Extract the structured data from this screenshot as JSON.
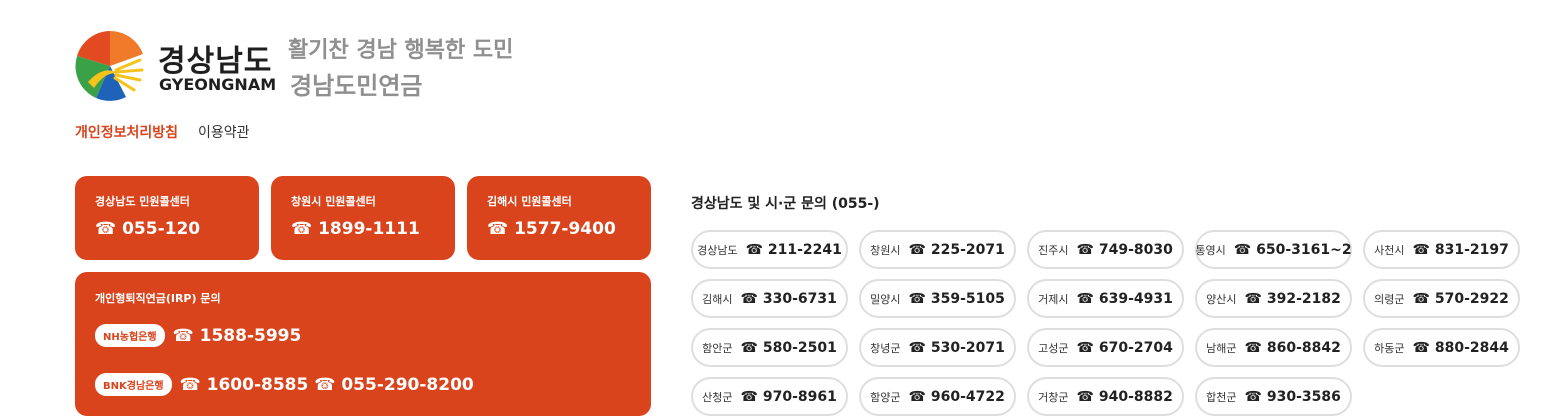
{
  "header": {
    "brand_ko": "경상남도",
    "brand_en": "GYEONGNAM",
    "slogan": "활기찬 경남 행복한 도민",
    "site_title": "경남도민연금"
  },
  "links": [
    {
      "label": "개인정보처리방침"
    },
    {
      "label": "이용약관"
    }
  ],
  "cards": [
    {
      "caption": "경상남도 민원콜센터",
      "phone": "☎ 055-120"
    },
    {
      "caption": "창원시 민원콜센터",
      "phone": "☎ 1899-1111"
    },
    {
      "caption": "김해시 민원콜센터",
      "phone": "☎ 1577-9400"
    }
  ],
  "irp": {
    "caption": "개인형퇴직연금(IRP) 문의",
    "rows": [
      {
        "bank": "NH농협은행",
        "phone": "☎ 1588-5995"
      },
      {
        "bank": "BNK경남은행",
        "phone": "☎ 1600-8585 ☎ 055-290-8200"
      }
    ]
  },
  "regions": {
    "title": "경상남도 및 시·군 문의 (055-)",
    "items": [
      {
        "name": "경상남도",
        "phone": "☎ 211-2241"
      },
      {
        "name": "창원시",
        "phone": "☎ 225-2071"
      },
      {
        "name": "진주시",
        "phone": "☎ 749-8030"
      },
      {
        "name": "통영시",
        "phone": "☎ 650-3161~2"
      },
      {
        "name": "사천시",
        "phone": "☎ 831-2197"
      },
      {
        "name": "김해시",
        "phone": "☎ 330-6731"
      },
      {
        "name": "밀양시",
        "phone": "☎ 359-5105"
      },
      {
        "name": "거제시",
        "phone": "☎ 639-4931"
      },
      {
        "name": "양산시",
        "phone": "☎ 392-2182"
      },
      {
        "name": "의령군",
        "phone": "☎ 570-2922"
      },
      {
        "name": "함안군",
        "phone": "☎ 580-2501"
      },
      {
        "name": "창녕군",
        "phone": "☎ 530-2071"
      },
      {
        "name": "고성군",
        "phone": "☎ 670-2704"
      },
      {
        "name": "남해군",
        "phone": "☎ 860-8842"
      },
      {
        "name": "하동군",
        "phone": "☎ 880-2844"
      },
      {
        "name": "산청군",
        "phone": "☎ 970-8961"
      },
      {
        "name": "함양군",
        "phone": "☎ 960-4722"
      },
      {
        "name": "거창군",
        "phone": "☎ 940-8882"
      },
      {
        "name": "합천군",
        "phone": "☎ 930-3586"
      }
    ]
  },
  "colors": {
    "accent": "#d9441d",
    "muted_text": "#8f8f8f",
    "pill_border": "#dedede"
  }
}
